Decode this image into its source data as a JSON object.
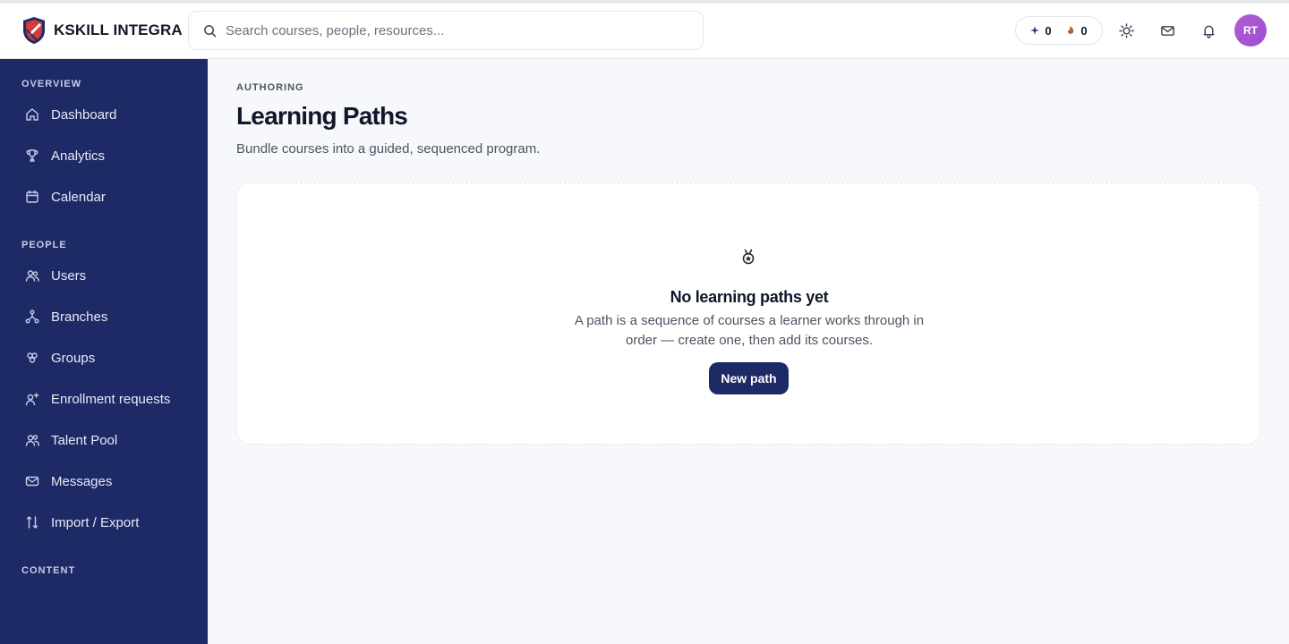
{
  "app": {
    "name": "KSKILL INTEGRA"
  },
  "search": {
    "placeholder": "Search courses, people, resources..."
  },
  "header": {
    "points": [
      {
        "icon": "sparkle-icon",
        "value": "0"
      },
      {
        "icon": "flame-icon",
        "value": "0"
      }
    ],
    "avatar_initials": "RT"
  },
  "sidebar": {
    "sections": [
      {
        "label": "OVERVIEW",
        "items": [
          {
            "label": "Dashboard",
            "icon": "home-icon"
          },
          {
            "label": "Analytics",
            "icon": "trophy-icon"
          },
          {
            "label": "Calendar",
            "icon": "calendar-icon"
          }
        ]
      },
      {
        "label": "PEOPLE",
        "items": [
          {
            "label": "Users",
            "icon": "users-icon"
          },
          {
            "label": "Branches",
            "icon": "branches-icon"
          },
          {
            "label": "Groups",
            "icon": "groups-icon"
          },
          {
            "label": "Enrollment requests",
            "icon": "user-plus-icon"
          },
          {
            "label": "Talent Pool",
            "icon": "talent-icon"
          },
          {
            "label": "Messages",
            "icon": "mail-icon"
          },
          {
            "label": "Import / Export",
            "icon": "import-export-icon"
          }
        ]
      },
      {
        "label": "CONTENT",
        "items": []
      }
    ]
  },
  "main": {
    "eyebrow": "AUTHORING",
    "title": "Learning Paths",
    "subtitle": "Bundle courses into a guided, sequenced program.",
    "empty_state": {
      "icon": "medal-icon",
      "title": "No learning paths yet",
      "description": "A path is a sequence of courses a learner works through in order — create one, then add its courses.",
      "button_label": "New path"
    }
  },
  "colors": {
    "sidebar_bg": "#1e2a66",
    "primary_button": "#1e2a66",
    "avatar": "#a855d4"
  }
}
